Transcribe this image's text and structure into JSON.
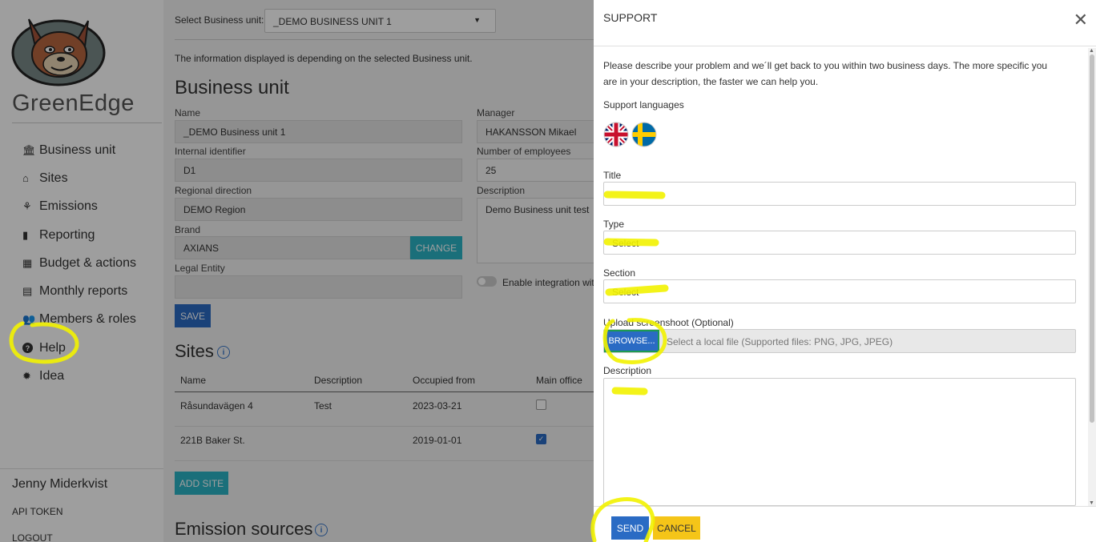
{
  "sidebar": {
    "brand": "GreenEdge",
    "items": [
      {
        "icon": "bank-icon",
        "glyph": "🏛",
        "label": "Business unit"
      },
      {
        "icon": "home-icon",
        "glyph": "⌂",
        "label": "Sites"
      },
      {
        "icon": "sprout-icon",
        "glyph": "⚘",
        "label": "Emissions"
      },
      {
        "icon": "chart-icon",
        "glyph": "▮",
        "label": "Reporting"
      },
      {
        "icon": "calculator-icon",
        "glyph": "▦",
        "label": "Budget & actions"
      },
      {
        "icon": "clipboard-icon",
        "glyph": "▤",
        "label": "Monthly reports"
      },
      {
        "icon": "users-icon",
        "glyph": "👥",
        "label": "Members & roles"
      },
      {
        "icon": "question-circle-icon",
        "glyph": "?",
        "label": "Help"
      },
      {
        "icon": "lightbulb-icon",
        "glyph": "✹",
        "label": "Idea"
      }
    ],
    "user_name": "Jenny Miderkvist",
    "api_token": "API TOKEN",
    "logout": "LOGOUT"
  },
  "main": {
    "bu_select_label": "Select Business unit:",
    "bu_select_value": "_DEMO BUSINESS UNIT 1",
    "info_text": "The information displayed is depending on the selected Business unit.",
    "section_title": "Business unit",
    "form": {
      "name_label": "Name",
      "name_value": "_DEMO Business unit 1",
      "internal_id_label": "Internal identifier",
      "internal_id_value": "D1",
      "regional_label": "Regional direction",
      "regional_value": "DEMO Region",
      "brand_label": "Brand",
      "brand_value": "AXIANS",
      "change_label": "CHANGE",
      "legal_label": "Legal Entity",
      "legal_value": "",
      "manager_label": "Manager",
      "manager_value": "HAKANSSON Mikael",
      "employees_label": "Number of employees",
      "employees_value": "25",
      "description_label": "Description",
      "description_value": "Demo Business unit test",
      "integration_label": "Enable integration with",
      "save_label": "SAVE"
    },
    "sites_title": "Sites",
    "sites_columns": [
      "Name",
      "Description",
      "Occupied from",
      "Main office"
    ],
    "sites_rows": [
      {
        "name": "Råsundavägen 4",
        "description": "Test",
        "occupied": "2023-03-21",
        "main_office": false
      },
      {
        "name": "221B Baker St.",
        "description": "",
        "occupied": "2019-01-01",
        "main_office": true
      }
    ],
    "add_site_label": "ADD SITE",
    "emission_title": "Emission sources"
  },
  "modal": {
    "title": "SUPPORT",
    "description": "Please describe your problem and we´ll get back to you within two business days. The more specific you are in your description, the faster we can help you.",
    "languages_label": "Support languages",
    "title_label": "Title",
    "title_value": "",
    "type_label": "Type",
    "type_value": "Select",
    "section_label": "Section",
    "section_value": "Select",
    "upload_label": "Upload screenshoot (Optional)",
    "browse_label": "BROWSE...",
    "upload_placeholder": "Select a local file (Supported files: PNG, JPG, JPEG)",
    "description_label": "Description",
    "send_label": "SEND",
    "cancel_label": "CANCEL"
  },
  "colors": {
    "primary": "#2a6bc4",
    "info": "#2bb3c6",
    "warning": "#f5c518",
    "highlight": "#f2f200"
  }
}
